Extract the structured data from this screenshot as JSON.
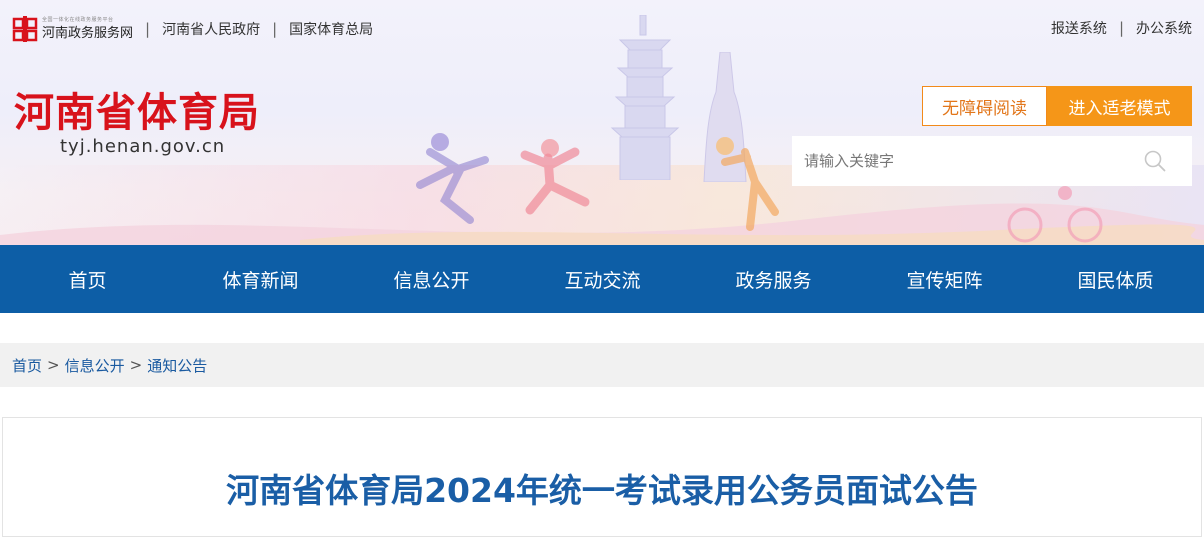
{
  "topbar": {
    "gov_logo_small": "全国一体化在线政务服务平台",
    "gov_logo_name": "河南政务服务网",
    "link1": "河南省人民政府",
    "link2": "国家体育总局",
    "sep": "|"
  },
  "top_right": {
    "link1": "报送系统",
    "link2": "办公系统",
    "sep": "|"
  },
  "site": {
    "title": "河南省体育局",
    "domain": "tyj.henan.gov.cn"
  },
  "buttons": {
    "accessibility": "无障碍阅读",
    "elderly_mode": "进入适老模式"
  },
  "search": {
    "placeholder": "请输入关键字",
    "icon": "search-icon"
  },
  "nav": {
    "items": [
      "首页",
      "体育新闻",
      "信息公开",
      "互动交流",
      "政务服务",
      "宣传矩阵",
      "国民体质"
    ]
  },
  "breadcrumb": {
    "items": [
      "首页",
      "信息公开",
      "通知公告"
    ],
    "separator": ">"
  },
  "article": {
    "title": "河南省体育局2024年统一考试录用公务员面试公告"
  },
  "colors": {
    "brand_red": "#d8121b",
    "nav_blue": "#0d5ea6",
    "title_blue": "#1a5ea6",
    "orange": "#f59618"
  }
}
